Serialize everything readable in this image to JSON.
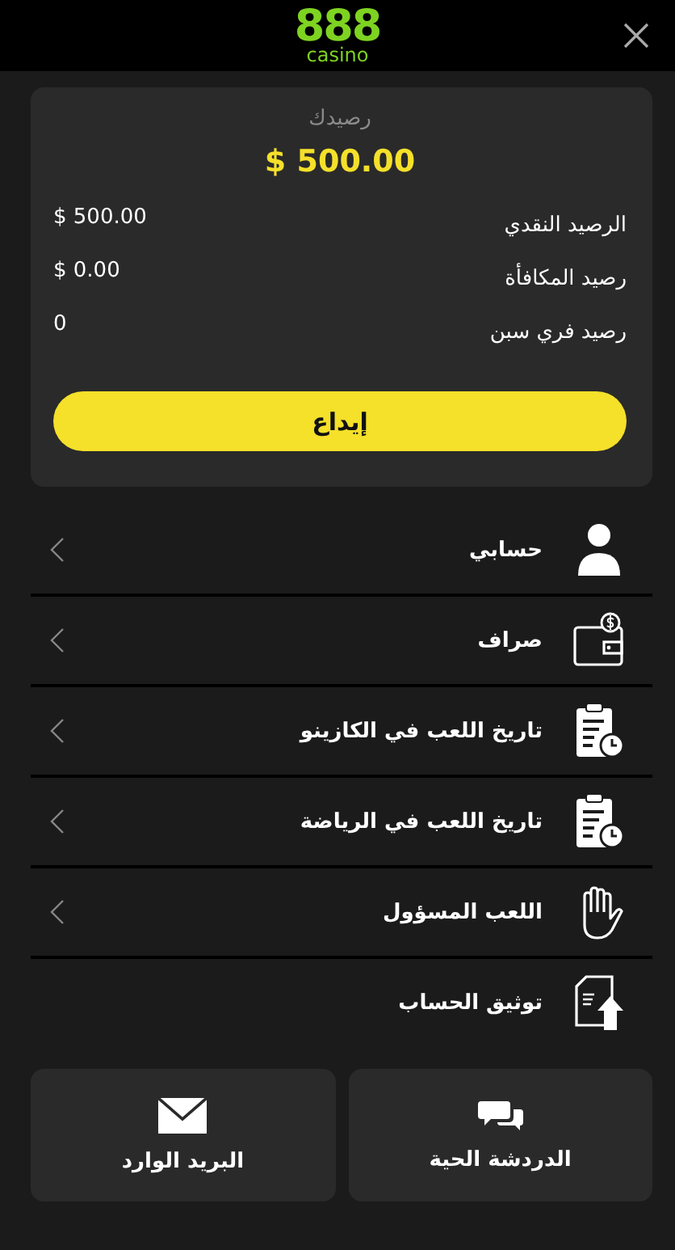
{
  "header": {
    "logo_number": "888",
    "logo_word": "casino"
  },
  "balance": {
    "title": "رصيدك",
    "total": "$ 500.00",
    "rows": [
      {
        "label": "الرصيد النقدي",
        "value": "$ 500.00"
      },
      {
        "label": "رصيد المكافأة",
        "value": "$ 0.00"
      },
      {
        "label": "رصيد فري سبن",
        "value": "0"
      }
    ],
    "deposit_button": "إيداع"
  },
  "menu": [
    {
      "kind": "person",
      "label": "حسابي",
      "arrow": true
    },
    {
      "kind": "wallet",
      "label": "صراف",
      "arrow": true
    },
    {
      "kind": "history",
      "label": "تاريخ اللعب في الكازينو",
      "arrow": true
    },
    {
      "kind": "history",
      "label": "تاريخ اللعب في الرياضة",
      "arrow": true
    },
    {
      "kind": "hand",
      "label": "اللعب المسؤول",
      "arrow": true
    },
    {
      "kind": "upload",
      "label": "توثيق الحساب",
      "arrow": false
    }
  ],
  "bottom_buttons": [
    {
      "kind": "chat",
      "label": "الدردشة الحية"
    },
    {
      "kind": "mail",
      "label": "البريد الوارد"
    }
  ]
}
